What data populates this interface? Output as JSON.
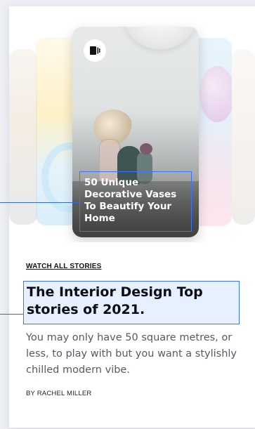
{
  "story_card": {
    "title": "50 Unique Decorative Vases To Beautify Your Home",
    "icon": "story-icon"
  },
  "watch_link_label": "WATCH ALL STORIES",
  "headline": "The Interior Design Top stories of 2021.",
  "description": "You may only have 50 square metres, or less, to play with but you want a stylishly chilled modern vibe.",
  "byline": "BY RACHEL MILLER",
  "colors": {
    "accent_outline": "#3a73ff",
    "headline_text": "#0c0d13",
    "body_text": "#555a63"
  }
}
